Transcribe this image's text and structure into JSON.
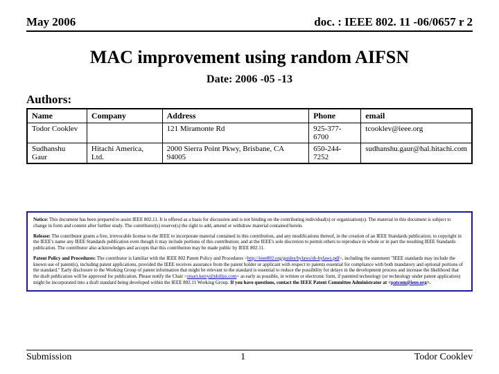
{
  "header": {
    "left": "May 2006",
    "right": "doc. : IEEE 802. 11 -06/0657 r 2"
  },
  "title": "MAC improvement using random AIFSN",
  "date_label": "Date: 2006 -05 -13",
  "authors_label": "Authors:",
  "table": {
    "headers": [
      "Name",
      "Company",
      "Address",
      "Phone",
      "email"
    ],
    "rows": [
      {
        "name": "Todor Cooklev",
        "company": "",
        "address": "121 Miramonte Rd",
        "phone": "925-377-6700",
        "email": "tcooklev@ieee.org"
      },
      {
        "name": "Sudhanshu Gaur",
        "company": "Hitachi America, Ltd.",
        "address": "2000 Sierra Point Pkwy, Brisbane, CA 94005",
        "phone": "650-244-7252",
        "email": "sudhanshu.gaur@hal.hitachi.com"
      }
    ]
  },
  "notice": {
    "p1_lead": "Notice:",
    "p1_body": " This document has been prepared to assist IEEE 802.11. It is offered as a basis for discussion and is not binding on the contributing individual(s) or organization(s). The material in this document is subject to change in form and content after further study. The contributor(s) reserve(s) the right to add, amend or withdraw material contained herein.",
    "p2_lead": "Release:",
    "p2_body": " The contributor grants a free, irrevocable license to the IEEE to incorporate material contained in this contribution, and any modifications thereof, in the creation of an IEEE Standards publication; to copyright in the IEEE's name any IEEE Standards publication even though it may include portions of this contribution; and at the IEEE's sole discretion to permit others to reproduce in whole or in part the resulting IEEE Standards publication. The contributor also acknowledges and accepts that this contribution may be made public by IEEE 802.11.",
    "p3_lead": "Patent Policy and Procedures:",
    "p3_body_a": " The contributor is familiar with the IEEE 802 Patent Policy and Procedures <",
    "p3_link1": "http://ieee802.org/guides/bylaws/sb-bylaws.pdf",
    "p3_body_b": ">, including the statement \"IEEE standards may include the known use of patent(s), including patent applications, provided the IEEE receives assurance from the patent holder or applicant with respect to patents essential for compliance with both mandatory and optional portions of the standard.\" Early disclosure to the Working Group of patent information that might be relevant to the standard is essential to reduce the possibility for delays in the development process and increase the likelihood that the draft publication will be approved for publication. Please notify the Chair <",
    "p3_link2": "stuart.kerry@philips.com",
    "p3_body_c": "> as early as possible, in written or electronic form, if patented technology (or technology under patent application) might be incorporated into a draft standard being developed within the IEEE 802.11 Working Group. ",
    "p3_bold_tail": "If you have questions, contact the IEEE Patent Committee Administrator at <",
    "p3_link3": "patcom@ieee.org",
    "p3_tail": ">."
  },
  "footer": {
    "left": "Submission",
    "center": "1",
    "right": "Todor Cooklev"
  }
}
